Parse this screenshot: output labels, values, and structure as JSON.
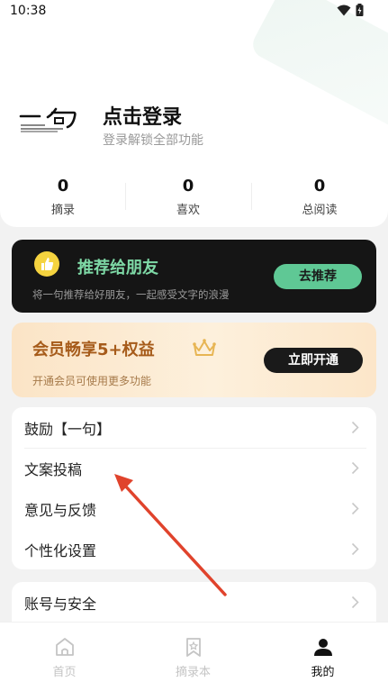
{
  "status_bar": {
    "time": "10:38"
  },
  "profile": {
    "login_title": "点击登录",
    "login_subtitle": "登录解锁全部功能",
    "stats": [
      {
        "value": "0",
        "label": "摘录"
      },
      {
        "value": "0",
        "label": "喜欢"
      },
      {
        "value": "0",
        "label": "总阅读"
      }
    ]
  },
  "recommend": {
    "title": "推荐给朋友",
    "description": "将一句推荐给好朋友，一起感受文字的浪漫",
    "button_label": "去推荐"
  },
  "vip": {
    "title": "会员畅享5+权益",
    "description": "开通会员可使用更多功能",
    "button_label": "立即开通"
  },
  "menu": {
    "items": [
      {
        "label": "鼓励【一句】"
      },
      {
        "label": "文案投稿"
      },
      {
        "label": "意见与反馈"
      },
      {
        "label": "个性化设置"
      }
    ],
    "account_label": "账号与安全"
  },
  "bottom_nav": {
    "items": [
      {
        "label": "首页",
        "icon": "home-icon"
      },
      {
        "label": "摘录本",
        "icon": "bookmark-icon"
      },
      {
        "label": "我的",
        "icon": "user-icon"
      }
    ],
    "active_index": 2
  },
  "colors": {
    "accent_green": "#5fc895",
    "vip_orange": "#a65b1a",
    "annotation_arrow": "#e0432c"
  }
}
